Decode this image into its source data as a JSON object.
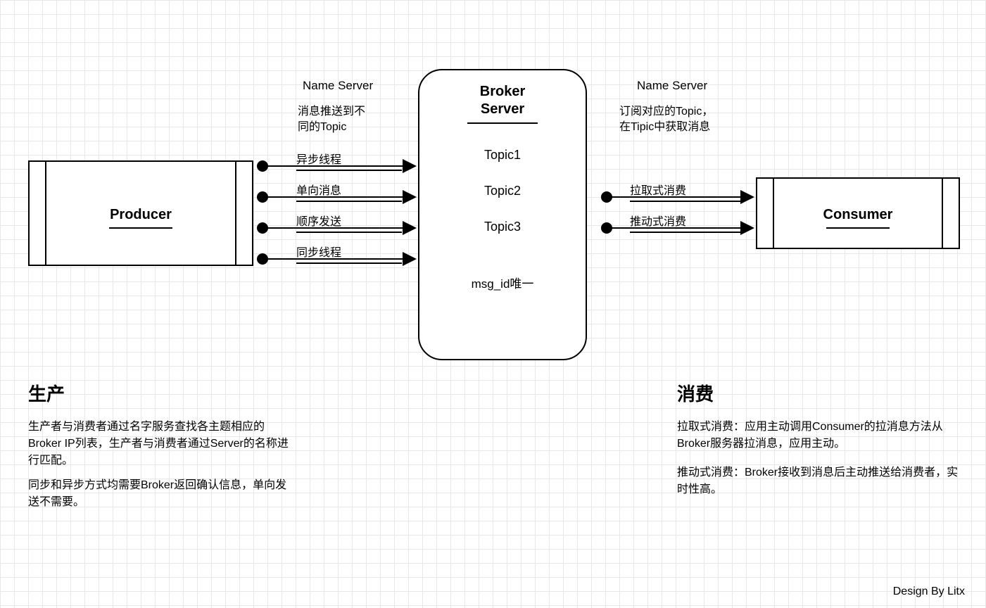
{
  "producer": {
    "title": "Producer"
  },
  "broker": {
    "title_l1": "Broker",
    "title_l2": "Server",
    "topics": [
      "Topic1",
      "Topic2",
      "Topic3"
    ],
    "note": "msg_id唯一"
  },
  "consumer": {
    "title": "Consumer"
  },
  "left_header": {
    "title": "Name Server",
    "desc_l1": "消息推送到不",
    "desc_l2": "同的Topic"
  },
  "right_header": {
    "title": "Name Server",
    "desc_l1": "订阅对应的Topic，",
    "desc_l2": "在Tipic中获取消息"
  },
  "producer_arrows": [
    "异步线程",
    "单向消息",
    "顺序发送",
    "同步线程"
  ],
  "consumer_arrows": [
    "拉取式消费",
    "推动式消费"
  ],
  "sections": {
    "produce": {
      "title": "生产",
      "p1": "生产者与消费者通过名字服务查找各主题相应的Broker IP列表，生产者与消费者通过Server的名称进行匹配。",
      "p2": "同步和异步方式均需要Broker返回确认信息，单向发送不需要。"
    },
    "consume": {
      "title": "消费",
      "p1": "拉取式消费：应用主动调用Consumer的拉消息方法从Broker服务器拉消息，应用主动。",
      "p2": "推动式消费：Broker接收到消息后主动推送给消费者，实时性高。"
    }
  },
  "footer": "Design  By Litx"
}
